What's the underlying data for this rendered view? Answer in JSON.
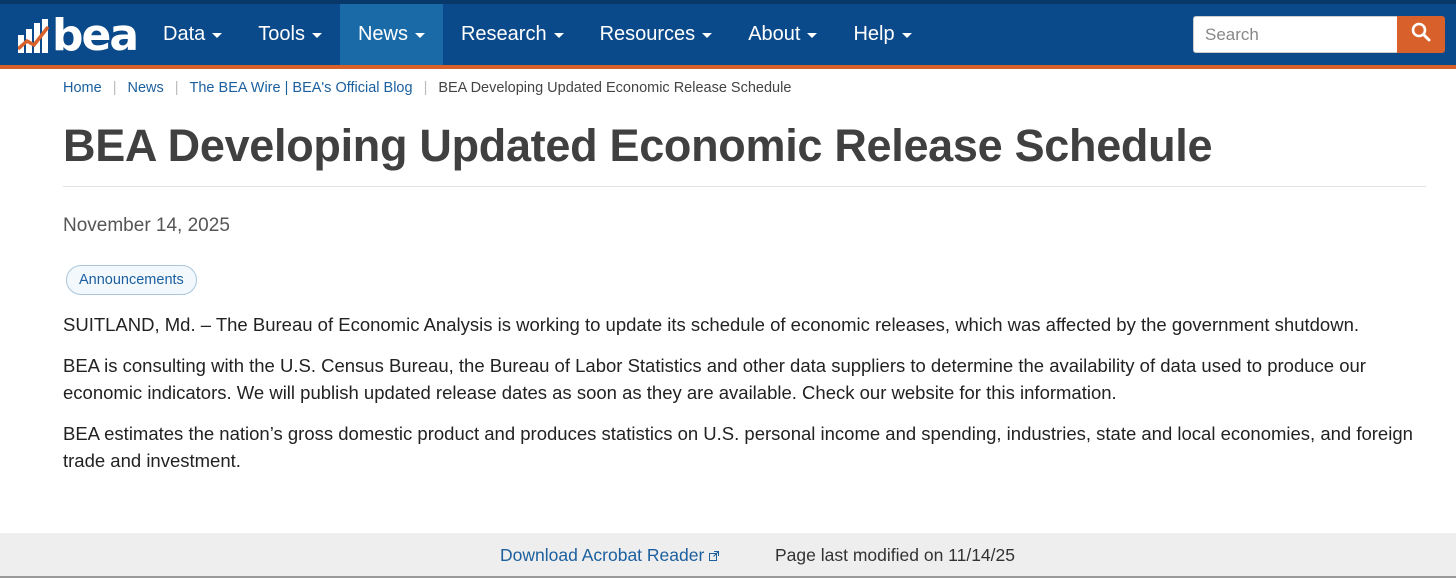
{
  "header": {
    "logo_text": "bea",
    "nav": [
      {
        "label": "Data",
        "active": false
      },
      {
        "label": "Tools",
        "active": false
      },
      {
        "label": "News",
        "active": true
      },
      {
        "label": "Research",
        "active": false
      },
      {
        "label": "Resources",
        "active": false
      },
      {
        "label": "About",
        "active": false
      },
      {
        "label": "Help",
        "active": false
      }
    ],
    "search_placeholder": "Search"
  },
  "breadcrumb": {
    "items": [
      "Home",
      "News",
      "The BEA Wire | BEA's Official Blog"
    ],
    "current": "BEA Developing Updated Economic Release Schedule"
  },
  "article": {
    "title": "BEA Developing Updated Economic Release Schedule",
    "date": "November 14, 2025",
    "tag": "Announcements",
    "paragraphs": [
      "SUITLAND, Md. – The Bureau of Economic Analysis is working to update its schedule of economic releases, which was affected by the government shutdown.",
      "BEA is consulting with the U.S. Census Bureau, the Bureau of Labor Statistics and other data suppliers to determine the availability of data used to produce our economic indicators. We will publish updated release dates as soon as they are available. Check our website for this information.",
      "BEA estimates the nation’s gross domestic product and produces statistics on U.S. personal income and spending, industries, state and local economies, and foreign trade and investment."
    ]
  },
  "footer": {
    "download_link": "Download Acrobat Reader",
    "last_modified": "Page last modified on 11/14/25"
  },
  "colors": {
    "navbar": "#0b4a8a",
    "nav_active": "#1b6aa8",
    "accent_orange": "#d8612b",
    "link": "#1b5f9e"
  },
  "icons": [
    "bea-logo-icon",
    "chevron-down-icon",
    "search-icon",
    "external-link-icon"
  ]
}
